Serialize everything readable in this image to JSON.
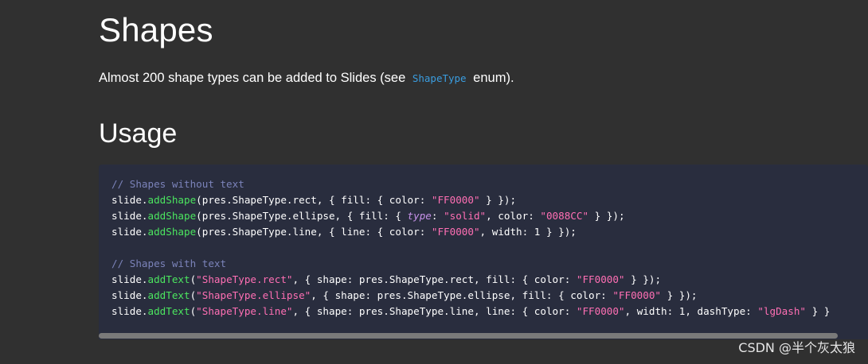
{
  "heading": "Shapes",
  "intro": {
    "before": "Almost 200 shape types can be added to Slides (see",
    "code": "ShapeType",
    "after": "enum)."
  },
  "usage_heading": "Usage",
  "code_block": {
    "lines": [
      [
        {
          "t": "// Shapes without text",
          "c": "com"
        }
      ],
      [
        {
          "t": "slide.",
          "c": "plain"
        },
        {
          "t": "addShape",
          "c": "fn"
        },
        {
          "t": "(pres.ShapeType.rect, { fill: { color: ",
          "c": "plain"
        },
        {
          "t": "\"FF0000\"",
          "c": "str"
        },
        {
          "t": " } });",
          "c": "plain"
        }
      ],
      [
        {
          "t": "slide.",
          "c": "plain"
        },
        {
          "t": "addShape",
          "c": "fn"
        },
        {
          "t": "(pres.ShapeType.ellipse, { fill: { ",
          "c": "plain"
        },
        {
          "t": "type",
          "c": "kw"
        },
        {
          "t": ": ",
          "c": "plain"
        },
        {
          "t": "\"solid\"",
          "c": "str"
        },
        {
          "t": ", color: ",
          "c": "plain"
        },
        {
          "t": "\"0088CC\"",
          "c": "str"
        },
        {
          "t": " } });",
          "c": "plain"
        }
      ],
      [
        {
          "t": "slide.",
          "c": "plain"
        },
        {
          "t": "addShape",
          "c": "fn"
        },
        {
          "t": "(pres.ShapeType.line, { line: { color: ",
          "c": "plain"
        },
        {
          "t": "\"FF0000\"",
          "c": "str"
        },
        {
          "t": ", width: 1 } });",
          "c": "plain"
        }
      ],
      [],
      [
        {
          "t": "// Shapes with text",
          "c": "com"
        }
      ],
      [
        {
          "t": "slide.",
          "c": "plain"
        },
        {
          "t": "addText",
          "c": "fn"
        },
        {
          "t": "(",
          "c": "plain"
        },
        {
          "t": "\"ShapeType.rect\"",
          "c": "str"
        },
        {
          "t": ", { shape: pres.ShapeType.rect, fill: { color: ",
          "c": "plain"
        },
        {
          "t": "\"FF0000\"",
          "c": "str"
        },
        {
          "t": " } });",
          "c": "plain"
        }
      ],
      [
        {
          "t": "slide.",
          "c": "plain"
        },
        {
          "t": "addText",
          "c": "fn"
        },
        {
          "t": "(",
          "c": "plain"
        },
        {
          "t": "\"ShapeType.ellipse\"",
          "c": "str"
        },
        {
          "t": ", { shape: pres.ShapeType.ellipse, fill: { color: ",
          "c": "plain"
        },
        {
          "t": "\"FF0000\"",
          "c": "str"
        },
        {
          "t": " } });",
          "c": "plain"
        }
      ],
      [
        {
          "t": "slide.",
          "c": "plain"
        },
        {
          "t": "addText",
          "c": "fn"
        },
        {
          "t": "(",
          "c": "plain"
        },
        {
          "t": "\"ShapeType.line\"",
          "c": "str"
        },
        {
          "t": ", { shape: pres.ShapeType.line, line: { color: ",
          "c": "plain"
        },
        {
          "t": "\"FF0000\"",
          "c": "str"
        },
        {
          "t": ", width: 1, dashType: ",
          "c": "plain"
        },
        {
          "t": "\"lgDash\"",
          "c": "str"
        },
        {
          "t": " } }",
          "c": "plain"
        }
      ]
    ]
  },
  "watermark": "CSDN @半个灰太狼",
  "colors": {
    "page_background": "#303030",
    "code_background": "#292d3e",
    "comment": "#7b83ba",
    "function": "#4be55f",
    "string": "#ff6fb4",
    "keyword": "#c792ea",
    "inline_code": "#3a9de0"
  }
}
